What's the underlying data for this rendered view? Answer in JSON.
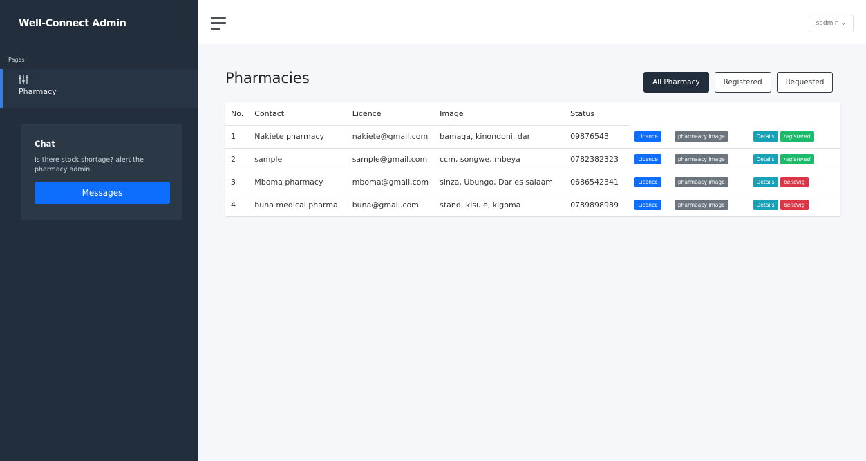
{
  "sidebar": {
    "brand": "Well-Connect Admin",
    "section_header": "Pages",
    "nav_item": {
      "label": "Pharmacy",
      "icon": "sliders-icon"
    },
    "cta": {
      "title": "Chat",
      "text": "Is there stock shortage? alert the pharmacy admin.",
      "button_label": "Messages"
    }
  },
  "topbar": {
    "user_label": "sadmin ⌄"
  },
  "main": {
    "title": "Pharmacies",
    "filters": [
      "All Pharmacy",
      "Registered",
      "Requested"
    ],
    "active_filter": "All Pharmacy",
    "table": {
      "headers": [
        "No.",
        "Contact",
        "Licence",
        "Image",
        "Status",
        "",
        "",
        ""
      ],
      "rows": [
        {
          "no": "1",
          "name": "Nakiete pharmacy",
          "email": "nakiete@gmail.com",
          "address": "bamaga, kinondoni, dar",
          "phone": "09876543",
          "licence": "Licence",
          "image": "pharmaacy image",
          "details": "Details",
          "status": "registered"
        },
        {
          "no": "2",
          "name": "sample",
          "email": "sample@gmail.com",
          "address": "ccm, songwe, mbeya",
          "phone": "0782382323",
          "licence": "Licence",
          "image": "pharmaacy image",
          "details": "Details",
          "status": "registered"
        },
        {
          "no": "3",
          "name": "Mboma pharmacy",
          "email": "mboma@gmail.com",
          "address": "sinza, Ubungo, Dar es salaam",
          "phone": "0686542341",
          "licence": "Licence",
          "image": "pharmaacy image",
          "details": "Details",
          "status": "pending"
        },
        {
          "no": "4",
          "name": "buna medical pharma",
          "email": "buna@gmail.com",
          "address": "stand, kisule, kigoma",
          "phone": "0789898989",
          "licence": "Licence",
          "image": "pharmaacy image",
          "details": "Details",
          "status": "pending"
        }
      ]
    }
  },
  "colors": {
    "sidebar_bg": "#222e3c",
    "primary": "#0d6efd",
    "registered": "#1cbb6c",
    "pending": "#dc3545",
    "details": "#17a2b8"
  }
}
